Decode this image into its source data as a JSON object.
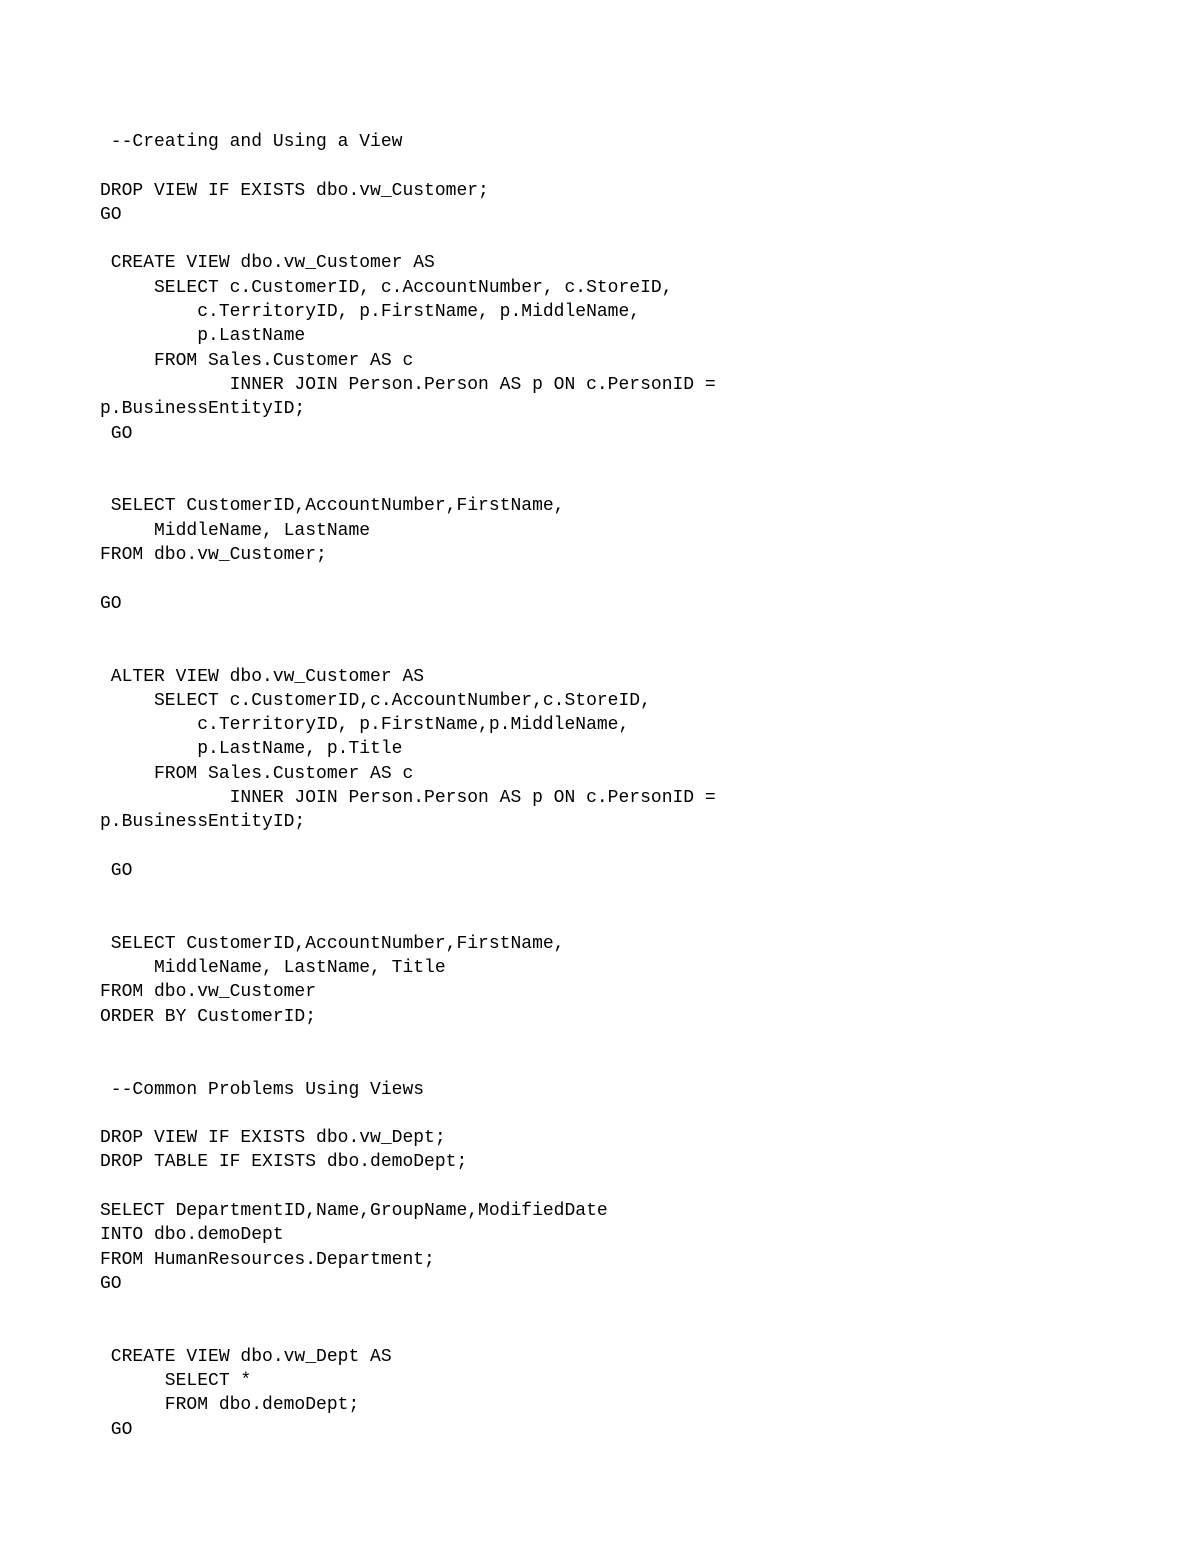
{
  "code": {
    "lines": [
      " --Creating and Using a View",
      "",
      "DROP VIEW IF EXISTS dbo.vw_Customer;",
      "GO",
      "",
      " CREATE VIEW dbo.vw_Customer AS",
      "     SELECT c.CustomerID, c.AccountNumber, c.StoreID,",
      "         c.TerritoryID, p.FirstName, p.MiddleName,",
      "         p.LastName",
      "     FROM Sales.Customer AS c",
      "            INNER JOIN Person.Person AS p ON c.PersonID =",
      "p.BusinessEntityID;",
      " GO",
      "",
      "",
      " SELECT CustomerID,AccountNumber,FirstName,",
      "     MiddleName, LastName",
      "FROM dbo.vw_Customer;",
      "",
      "GO",
      "",
      "",
      " ALTER VIEW dbo.vw_Customer AS",
      "     SELECT c.CustomerID,c.AccountNumber,c.StoreID,",
      "         c.TerritoryID, p.FirstName,p.MiddleName,",
      "         p.LastName, p.Title",
      "     FROM Sales.Customer AS c",
      "            INNER JOIN Person.Person AS p ON c.PersonID =",
      "p.BusinessEntityID;",
      "",
      " GO",
      "",
      "",
      " SELECT CustomerID,AccountNumber,FirstName,",
      "     MiddleName, LastName, Title",
      "FROM dbo.vw_Customer",
      "ORDER BY CustomerID;",
      "",
      "",
      " --Common Problems Using Views",
      "",
      "DROP VIEW IF EXISTS dbo.vw_Dept;",
      "DROP TABLE IF EXISTS dbo.demoDept;",
      "",
      "SELECT DepartmentID,Name,GroupName,ModifiedDate",
      "INTO dbo.demoDept",
      "FROM HumanResources.Department;",
      "GO",
      "",
      "",
      " CREATE VIEW dbo.vw_Dept AS",
      "      SELECT *",
      "      FROM dbo.demoDept;",
      " GO"
    ]
  }
}
